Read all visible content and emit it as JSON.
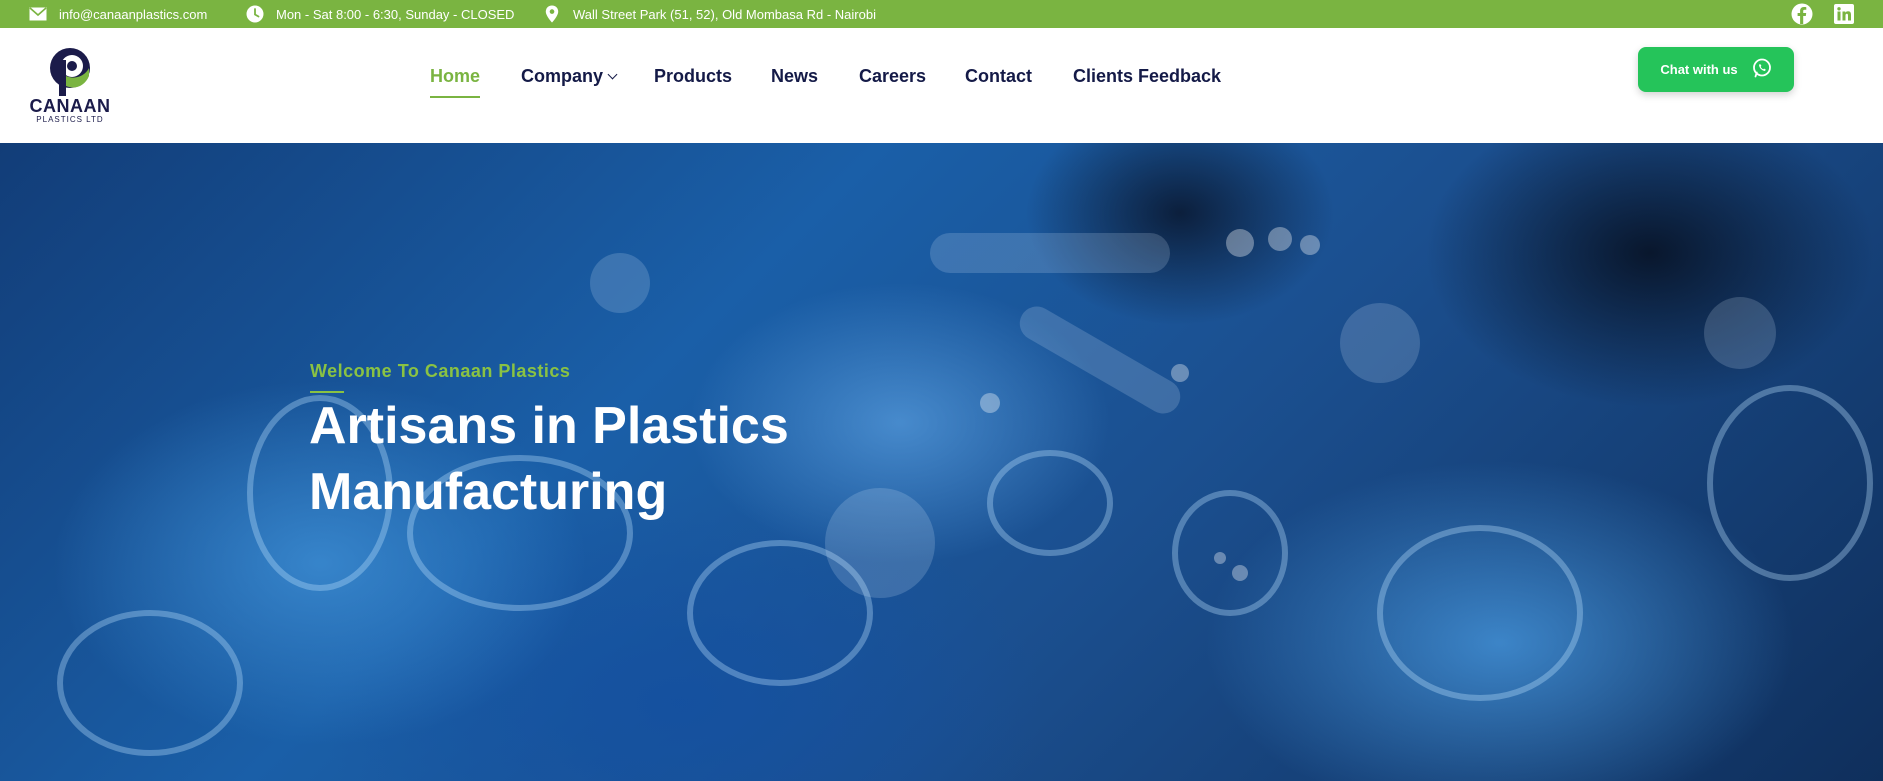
{
  "topbar": {
    "email": "info@canaanplastics.com",
    "hours": "Mon - Sat 8:00 - 6:30, Sunday - CLOSED",
    "address": "Wall Street Park (51, 52), Old Mombasa Rd - Nairobi",
    "icons": [
      "envelope-icon",
      "clock-icon",
      "map-pin-icon",
      "facebook-icon",
      "linkedin-icon"
    ],
    "background": "#7ab441"
  },
  "logo": {
    "name": "CANAAN",
    "subtitle": "PLASTICS LTD"
  },
  "nav": {
    "items": [
      {
        "label": "Home",
        "active": true
      },
      {
        "label": "Company",
        "has_dropdown": true
      },
      {
        "label": "Products"
      },
      {
        "label": "News"
      },
      {
        "label": "Careers"
      },
      {
        "label": "Contact"
      },
      {
        "label": "Clients Feedback"
      }
    ]
  },
  "chat": {
    "label": "Chat with us",
    "icon": "whatsapp-icon",
    "color": "#25c45a"
  },
  "hero": {
    "eyebrow": "Welcome To Canaan Plastics",
    "title_line1": "Artisans in Plastics",
    "title_line2": "Manufacturing"
  },
  "colors": {
    "accent": "#7ab441",
    "nav_text": "#141a47"
  }
}
